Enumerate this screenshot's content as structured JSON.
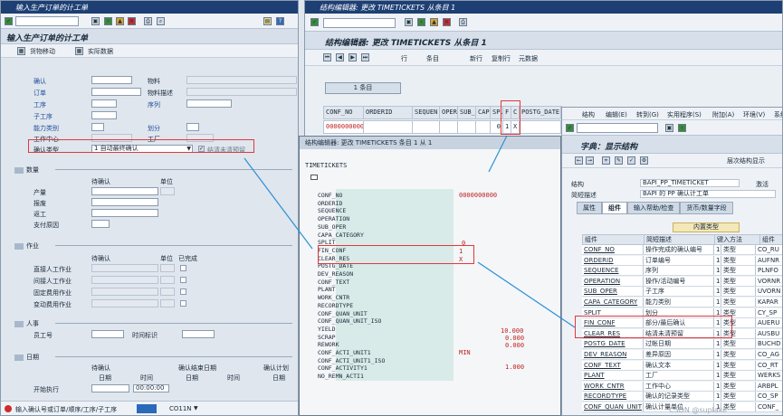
{
  "left": {
    "title": "输入生产订单的计工单",
    "page_title": "输入生产订单的计工单",
    "toolbar": [
      "货物移动",
      "实际数据"
    ],
    "fields": {
      "op": "确认",
      "order": "订单",
      "operation": "工序",
      "suboper": "子工序",
      "capcat": "能力类别",
      "workcenter": "工作中心",
      "conftype": "确认类型",
      "material": "物料",
      "matdesc": "物料描述",
      "seq": "序列",
      "split": "划分",
      "plant": "工厂",
      "conftype_value": "1 自动最终确认",
      "clear_res_label": "结清未清预留"
    },
    "qty": {
      "title": "数量",
      "to_confirm": "待确认",
      "unit": "单位",
      "rows": [
        "产量",
        "报废",
        "返工",
        "支付原因"
      ]
    },
    "activity": {
      "title": "作业",
      "to_confirm": "待确认",
      "unit": "单位",
      "done": "已完成",
      "rows": [
        "直接人工作业",
        "间接人工作业",
        "固定费用作业",
        "变动费用作业"
      ]
    },
    "personnel": {
      "title": "人事",
      "emp": "员工号",
      "time_id": "时间标识"
    },
    "dates": {
      "title": "日期",
      "to_confirm": "待确认",
      "end_date": "确认结束日期",
      "confirm_to": "确认计划",
      "date": "日期",
      "time": "时间",
      "start": "开始执行",
      "time_value": "00:00:00"
    },
    "status": {
      "text": "输入确认号或订单/顺序/工序/子工序",
      "tcode": "CO11N"
    }
  },
  "mid": {
    "title": "结构编辑器: 更改 TIMETICKETS 从条目 1",
    "page_title": "结构编辑器: 更改 TIMETICKETS 从条目 1",
    "toolbar": [
      "行",
      "条目",
      "新行",
      "复制行",
      "元数据"
    ],
    "entry_btn": "1 条目",
    "cols": [
      "CONF_NO",
      "ORDERID",
      "SEQUEN",
      "OPER",
      "SUB_",
      "CAP",
      "SPL",
      "F",
      "C",
      "POSTG_DATE"
    ],
    "row": {
      "conf_no": "0000000000",
      "spl": "0",
      "f": "1",
      "c": "X"
    }
  },
  "popup": {
    "title": "结构编辑器: 更改 TIMETICKETS 条目 1 从 1",
    "root": "TIMETICKETS",
    "fields": [
      "CONF_NO",
      "ORDERID",
      "SEQUENCE",
      "OPERATION",
      "SUB_OPER",
      "CAPA_CATEGORY",
      "SPLIT",
      "FIN_CONF",
      "CLEAR_RES",
      "POSTG_DATE",
      "DEV_REASON",
      "CONF_TEXT",
      "PLANT",
      "WORK_CNTR",
      "RECORDTYPE",
      "CONF_QUAN_UNIT",
      "CONF_QUAN_UNIT_ISO",
      "YIELD",
      "SCRAP",
      "REWORK",
      "CONF_ACTI_UNIT1",
      "CONF_ACTI_UNIT1_ISO",
      "CONF_ACTIVITY1",
      "NO_REMN_ACTI1"
    ],
    "values": {
      "conf_no": "0000000000",
      "split": "0",
      "fin_conf": "1",
      "clear_res": "X",
      "yield": "10.000",
      "scrap": "0.000",
      "rework": "0.000",
      "acti_unit": "MIN",
      "activity": "1.000"
    }
  },
  "right": {
    "menu": [
      "结构",
      "编辑(E)",
      "转到(G)",
      "实用程序(S)",
      "附加(A)",
      "环境(V)",
      "系统"
    ],
    "page_title": "字典：显示结构",
    "toolbar_btn": "层次结构显示",
    "struct_lbl": "结构",
    "struct_val": "BAPI_PP_TIMETICKET",
    "status_val": "激活",
    "desc_lbl": "简短描述",
    "desc_val": "BAPI 的 PP 确认计工单",
    "tabs": [
      "属性",
      "组件",
      "输入帮助/检查",
      "货币/数量字段"
    ],
    "builtin": "内置类型",
    "cols": [
      "组件",
      "简短描述",
      "键入方法",
      "组件"
    ],
    "rows": [
      [
        "CONF_NO",
        "操作完成的确认编号",
        "1",
        "类型",
        "CO_RU"
      ],
      [
        "ORDERID",
        "订单编号",
        "1",
        "类型",
        "AUFNR"
      ],
      [
        "SEQUENCE",
        "序列",
        "1",
        "类型",
        "PLNFO"
      ],
      [
        "OPERATION",
        "操作/活动编号",
        "1",
        "类型",
        "VORNR"
      ],
      [
        "SUB_OPER",
        "子工序",
        "1",
        "类型",
        "UVORN"
      ],
      [
        "CAPA_CATEGORY",
        "能力类别",
        "1",
        "类型",
        "KAPAR"
      ],
      [
        "SPLIT",
        "划分",
        "1",
        "类型",
        "CY_SP"
      ],
      [
        "FIN_CONF",
        "部分/最后确认",
        "1",
        "类型",
        "AUERU"
      ],
      [
        "CLEAR_RES",
        "结清未清预留",
        "1",
        "类型",
        "AUSBU"
      ],
      [
        "POSTG_DATE",
        "过帐日期",
        "1",
        "类型",
        "BUCHD"
      ],
      [
        "DEV_REASON",
        "差异原因",
        "1",
        "类型",
        "CO_AG"
      ],
      [
        "CONF_TEXT",
        "确认文本",
        "1",
        "类型",
        "CO_RT"
      ],
      [
        "PLANT",
        "工厂",
        "1",
        "类型",
        "WERKS"
      ],
      [
        "WORK_CNTR",
        "工作中心",
        "1",
        "类型",
        "ARBPL"
      ],
      [
        "RECORDTYPE",
        "确认的记录类型",
        "1",
        "类型",
        "CO_SP"
      ],
      [
        "CONF_QUAN_UNIT",
        "确认计量单位",
        "1",
        "类型",
        "CONF_"
      ]
    ]
  },
  "watermark": "CSDN @suplake"
}
